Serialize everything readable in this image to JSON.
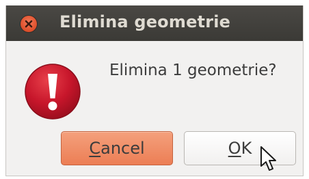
{
  "window": {
    "title": "Elimina geometrie"
  },
  "dialog": {
    "message": "Elimina 1 geometrie?",
    "icon": "error-exclamation-icon"
  },
  "buttons": {
    "cancel": {
      "mnemonic": "C",
      "rest": "ancel"
    },
    "ok": {
      "mnemonic": "O",
      "rest": "K"
    }
  },
  "colors": {
    "titlebar": "#3c3b37",
    "close_button": "#e95420",
    "title_text": "#dfdbd2",
    "dialog_bg": "#f2f1f0",
    "icon_red": "#c7162b",
    "cancel_button": "#f08a5d"
  }
}
